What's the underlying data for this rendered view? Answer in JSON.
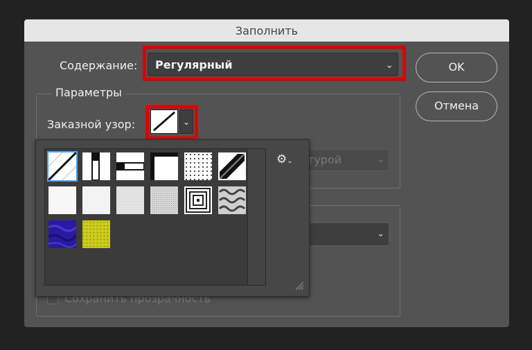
{
  "dialog": {
    "title": "Заполнить",
    "content_label": "Содержание:",
    "content_value": "Регулярный",
    "ok_label": "OK",
    "cancel_label": "Отмена"
  },
  "params": {
    "legend": "Параметры",
    "pattern_label": "Заказной узор:",
    "hidden_select_text": "турой",
    "preserve_transparency_label": "Сохранить прозрачность"
  },
  "pattern_picker": {
    "selected_index": 0,
    "patterns": [
      {
        "name": "diagonal-line-pattern"
      },
      {
        "name": "vertical-bar-pattern"
      },
      {
        "name": "horizontal-bar-pattern"
      },
      {
        "name": "corner-frame-pattern"
      },
      {
        "name": "dots-pattern"
      },
      {
        "name": "diagonal-block-pattern"
      },
      {
        "name": "white-paper-pattern"
      },
      {
        "name": "light-paper-pattern"
      },
      {
        "name": "gray-noise-pattern"
      },
      {
        "name": "speckle-noise-pattern"
      },
      {
        "name": "concentric-squares-pattern"
      },
      {
        "name": "cloud-texture-pattern"
      },
      {
        "name": "blue-texture-pattern"
      },
      {
        "name": "yellow-texture-pattern"
      }
    ]
  },
  "colors": {
    "highlight_red": "#e00000",
    "selection_blue": "#4aa3ff",
    "dialog_bg": "#535353",
    "title_bg": "#e6e6e6"
  }
}
